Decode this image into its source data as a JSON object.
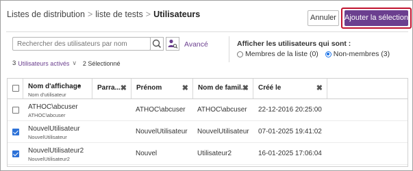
{
  "header": {
    "breadcrumb": [
      "Listes de distribution",
      "liste de tests",
      "Utilisateurs"
    ],
    "breadcrumb_sep": ">",
    "cancel_label": "Annuler",
    "add_label": "Ajouter la sélection"
  },
  "search": {
    "placeholder": "Rechercher des utilisateurs par nom",
    "value": "",
    "advanced_label": "Avancé"
  },
  "filter": {
    "title": "Afficher les utilisateurs qui sont :",
    "options": [
      {
        "label": "Membres de la liste (0)",
        "selected": false
      },
      {
        "label": "Non-membres (3)",
        "selected": true
      }
    ]
  },
  "status": {
    "active_count": "3",
    "active_label": "Utilisateurs activés",
    "chevron": "∨",
    "selected_text": "2 Sélectionné"
  },
  "table": {
    "columns": [
      {
        "label": "Nom d'affichage",
        "sub": "Nom d'utilisateur",
        "sort": "▲"
      },
      {
        "label": "Parra...",
        "close": "✖"
      },
      {
        "label": "Prénom",
        "close": "✖"
      },
      {
        "label": "Nom de famil...",
        "close": "✖"
      },
      {
        "label": "Créé le",
        "close": "✖"
      }
    ],
    "rows": [
      {
        "checked": false,
        "display_name": "ATHOC\\abcuser",
        "username": "ATHOC\\abcuser",
        "sponsor": "",
        "first_name": "ATHOC\\abcuser",
        "last_name": "ATHOC\\abcuser",
        "created": "22-12-2016 20:25:00"
      },
      {
        "checked": true,
        "display_name": "NouvelUtilisateur",
        "username": "NouvelUtilisateur",
        "sponsor": "",
        "first_name": "NouvelUtilisateur",
        "last_name": "NouvelUtilisateur",
        "created": "07-01-2025 19:41:02"
      },
      {
        "checked": true,
        "display_name": "NouvelUtilisateur2",
        "username": "NouvelUtilisateur2",
        "sponsor": "",
        "first_name": "Nouvel",
        "last_name": "Utilisateur2",
        "created": "16-01-2025 17:06:04"
      }
    ]
  },
  "colors": {
    "accent": "#6b3f8f",
    "highlight": "#c0122e",
    "checkbox": "#2d72d8"
  },
  "icons": {
    "search": "search-icon",
    "advanced": "advanced-search-icon",
    "close": "close-icon",
    "sort": "sort-ascending-icon"
  }
}
